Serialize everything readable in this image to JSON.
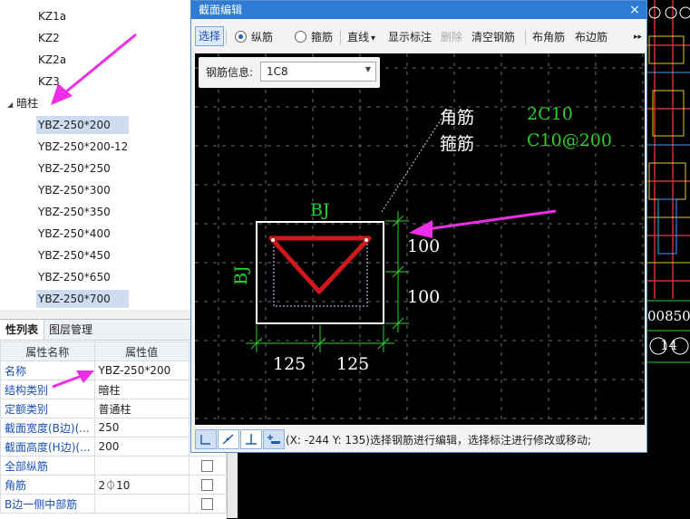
{
  "tree": {
    "items_top": [
      "KZ1a",
      "KZ2",
      "KZ2a",
      "KZ3"
    ],
    "group_label": "暗柱",
    "items": [
      "YBZ-250*200",
      "YBZ-250*200-12",
      "YBZ-250*250",
      "YBZ-250*300",
      "YBZ-250*350",
      "YBZ-250*400",
      "YBZ-250*450",
      "YBZ-250*650",
      "YBZ-250*700"
    ]
  },
  "props": {
    "tabs": [
      "性列表",
      "图层管理"
    ],
    "header": {
      "name": "属性名称",
      "value": "属性值"
    },
    "rows": [
      {
        "name": "名称",
        "value": "YBZ-250*200"
      },
      {
        "name": "结构类别",
        "value": "暗柱"
      },
      {
        "name": "定额类别",
        "value": "普通柱"
      },
      {
        "name": "截面宽度(B边)(...",
        "value": "250"
      },
      {
        "name": "截面高度(H边)(...",
        "value": "200"
      },
      {
        "name": "全部纵筋",
        "value": ""
      },
      {
        "name": "角筋",
        "value": "2⏀10"
      },
      {
        "name": "B边一侧中部筋",
        "value": ""
      }
    ]
  },
  "dialog": {
    "title": "截面编辑",
    "close": "×",
    "toolbar": {
      "select": "选择",
      "longitudinal": "纵筋",
      "stirrup": "箍筋",
      "line": "直线",
      "line_arrow": "▾",
      "show_label": "显示标注",
      "delete": "删除",
      "clear": "清空钢筋",
      "corner": "布角筋",
      "edge": "布边筋",
      "more": "▸▸"
    },
    "steel_info": {
      "label": "钢筋信息:",
      "value": "1C8"
    },
    "drawing": {
      "corner_label": "角筋",
      "corner_value": "2C10",
      "stirrup_label": "箍筋",
      "stirrup_value": "C10@200",
      "bj_top": "BJ",
      "bj_left": "BJ",
      "dim_right_1": "100",
      "dim_right_2": "100",
      "dim_bottom_1": "125",
      "dim_bottom_2": "125"
    },
    "status": "(X: -244 Y: 135)选择钢筋进行编辑，选择标注进行修改或移动;"
  },
  "cad": {
    "label_a": "00850",
    "label_b": "14"
  },
  "colors": {
    "accent": "#2e7bd6",
    "rebar": "#d0181c",
    "dim_green": "#2bd22b",
    "annotation_arrow": "#ee2ee6"
  }
}
